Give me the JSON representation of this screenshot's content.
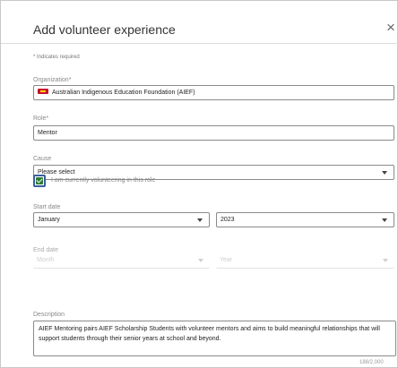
{
  "dialog": {
    "title": "Add volunteer experience",
    "close_icon": "close-icon",
    "required_note": "* Indicates required"
  },
  "organization": {
    "label": "Organization*",
    "value": "Australian Indigenous Education Foundation (AIEF)",
    "logo_icon": "organization-logo-icon"
  },
  "role": {
    "label": "Role*",
    "value": "Mentor"
  },
  "cause": {
    "label": "Cause",
    "value": "Please select"
  },
  "current": {
    "label": "I am currently volunteering in this role",
    "checked": true
  },
  "start_date": {
    "label": "Start date",
    "month": "January",
    "year": "2023"
  },
  "end_date": {
    "label": "End date",
    "month_placeholder": "Month",
    "year_placeholder": "Year"
  },
  "description": {
    "label": "Description",
    "value": "AIEF Mentoring pairs AIEF Scholarship Students with volunteer mentors and aims to build meaningful relationships that will support students through their senior years at school and beyond.",
    "counter": "188/2,000"
  },
  "colors": {
    "checkbox_border": "#3a5f9f",
    "checkbox_fill": "#2e7d32",
    "org_logo": "#c8102e"
  }
}
